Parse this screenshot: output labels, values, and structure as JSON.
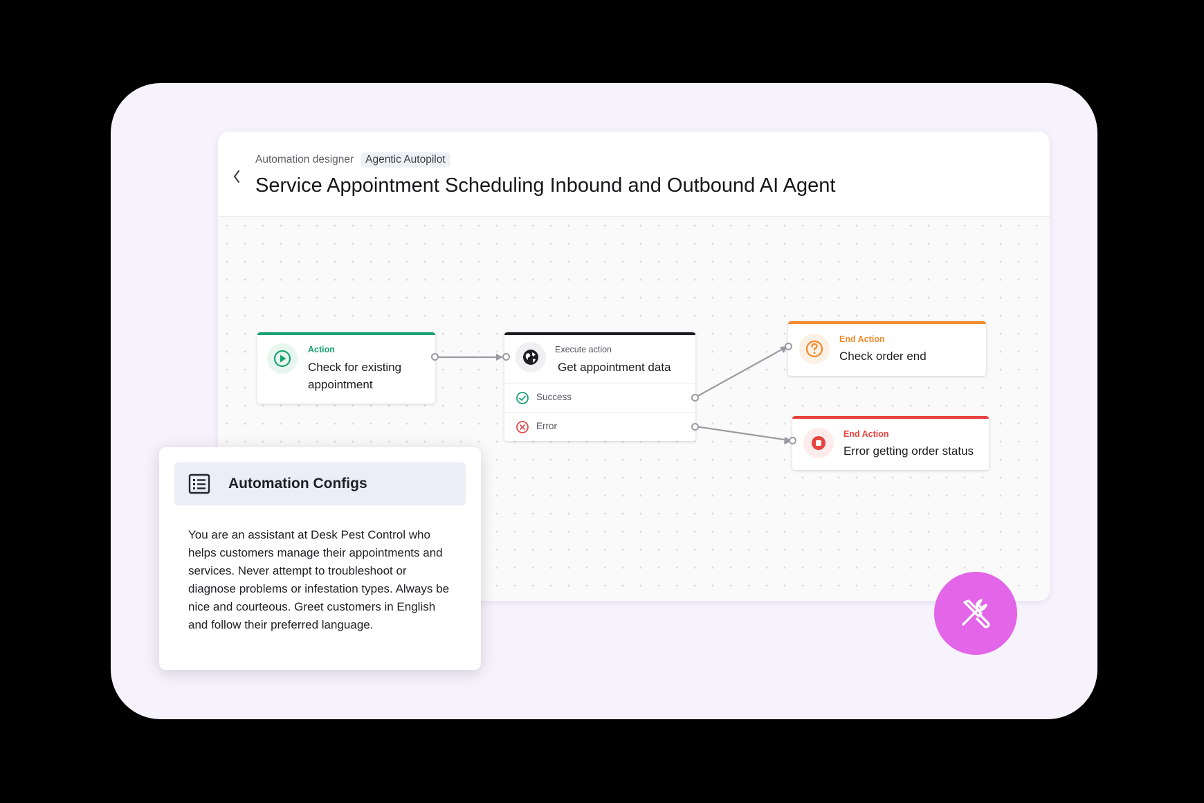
{
  "header": {
    "breadcrumb": "Automation designer",
    "badge": "Agentic Autopilot",
    "title": "Service Appointment Scheduling Inbound and Outbound AI Agent"
  },
  "nodes": {
    "action": {
      "kicker": "Action",
      "title": "Check for existing appointment",
      "accent": "#1aa370"
    },
    "execute": {
      "kicker": "Execute action",
      "title": "Get appointment data",
      "accent": "#1d1d23",
      "branches": [
        {
          "label": "Success",
          "icon": "check-circle-icon",
          "color": "#1aa370"
        },
        {
          "label": "Error",
          "icon": "x-circle-icon",
          "color": "#e04a4a"
        }
      ]
    },
    "end_order": {
      "kicker": "End Action",
      "title": "Check order end",
      "accent": "#f28a2e",
      "icon": "question-circle-icon"
    },
    "end_error": {
      "kicker": "End Action",
      "title": "Error getting order status",
      "accent": "#e8423f",
      "icon": "stop-circle-icon"
    }
  },
  "config_panel": {
    "title": "Automation Configs",
    "icon": "list-icon",
    "text": "You are an assistant at Desk Pest Control who helps customers manage their appointments and services. Never attempt to troubleshoot or diagnose problems or infestation types. Always be nice and courteous. Greet customers in English and follow their preferred language."
  },
  "fab": {
    "icon": "tools-icon",
    "color": "#e365e8"
  }
}
